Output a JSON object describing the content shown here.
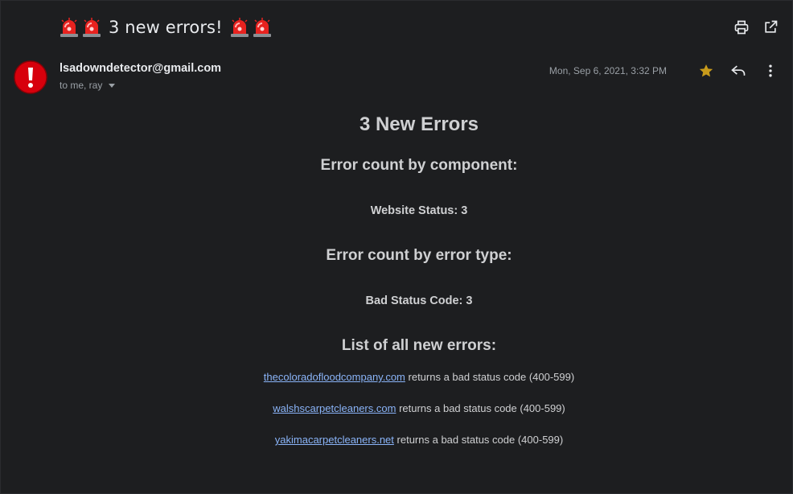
{
  "subject": {
    "text": "3 new errors!",
    "icon": "police-siren-emoji"
  },
  "sender": {
    "email": "lsadowndetector@gmail.com",
    "recipients": "to me, ray",
    "date": "Mon, Sep 6, 2021, 3:32 PM",
    "avatar_icon": "exclamation-alert-icon"
  },
  "colors": {
    "background": "#1d1e20",
    "link": "#8ab4f8",
    "star": "#c89b1b",
    "avatar_red": "#d7000c"
  },
  "body": {
    "title": "3 New Errors",
    "by_component_heading": "Error count by component:",
    "component_stat": "Website Status: 3",
    "by_type_heading": "Error count by error type:",
    "type_stat": "Bad Status Code: 3",
    "list_heading": "List of all new errors:",
    "errors": [
      {
        "domain": "thecoloradofloodcompany.com",
        "message": "returns a bad status code (400-599)"
      },
      {
        "domain": "walshscarpetcleaners.com",
        "message": "returns a bad status code (400-599)"
      },
      {
        "domain": "yakimacarpetcleaners.net",
        "message": "returns a bad status code (400-599)"
      }
    ]
  }
}
